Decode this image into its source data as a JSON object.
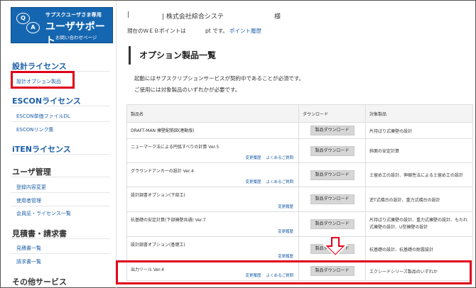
{
  "logo": {
    "tiny": "サプスクユーザさま専用",
    "title": "ユーザサポート",
    "sub": "お問い合わせページ",
    "q": "Q",
    "a": "A"
  },
  "sidebar": {
    "sections": [
      {
        "title": "設計ライセンス",
        "items": [
          "設計オプション製品"
        ]
      },
      {
        "title": "ESCONライセンス",
        "items": [
          "ESCON単価ファイルDL",
          "ESCONリンク集"
        ]
      },
      {
        "title": "iTENライセンス",
        "items": []
      },
      {
        "title": "ユーザ管理",
        "items": [
          "登録内容変更",
          "使用者管理",
          "会員証・ライセンス一覧"
        ]
      },
      {
        "title": "見積書・請求書",
        "items": [
          "見積書一覧",
          "請求書一覧"
        ]
      },
      {
        "title": "その他サービス",
        "items": []
      }
    ]
  },
  "header": {
    "company_left": "|",
    "company": "| 株式会社綜合システ",
    "honorific": "様",
    "points_text": "現在のＷＥＢポイントは",
    "points_unit": "pt です。",
    "points_link": "ポイント履歴"
  },
  "page": {
    "title": "オプション製品一覧",
    "desc1": "起動にはサブスクリプションサービスが契約中であることが必須です。",
    "desc2": "ご使用には対象製品のいずれかが必要です。"
  },
  "table": {
    "headers": [
      "製品名",
      "ダウンロード",
      "対象製品"
    ],
    "button_label": "製品ダウンロード",
    "rows": [
      {
        "name": "DRAFT-MAN 擁壁配筋図(連動版)",
        "links": [],
        "target": "片持ばり式擁壁の設計"
      },
      {
        "name": "ニューマーク法による円弧すべりの計算 Ver.5",
        "links": [
          "変更履歴",
          "よくあるご質問"
        ],
        "target": "斜面の安定計算"
      },
      {
        "name": "グラウンドアンカーの設計 Ver.4",
        "links": [
          "変更履歴",
          "よくあるご質問"
        ],
        "target": "土留め工の設計、伸縮性法による土留め工の設計"
      },
      {
        "name": "設計調書オプション(下部工)",
        "links": [
          "変更履歴"
        ],
        "target": "逆T式橋台の設計、重力式橋台の設計"
      },
      {
        "name": "杭基礎の安定計算(下部擁壁共通) Ver.7",
        "links": [
          "変更履歴"
        ],
        "target": "片持ばり式擁壁の設計、重力式擁壁の設計、もたれ式擁壁の設計、U型擁壁の設計"
      },
      {
        "name": "設計調書オプション(基礎工)",
        "links": [
          "変更履歴"
        ],
        "target": "杭基礎の設計、杭基礎の耐震設計"
      },
      {
        "name": "出力ツール Ver.4",
        "links": [
          "変更履歴",
          "よくあるご質問"
        ],
        "target": "エクシードシリーズ製品のいずれか"
      }
    ]
  },
  "colors": {
    "accent": "#1566b0",
    "highlight": "#e0001b"
  }
}
